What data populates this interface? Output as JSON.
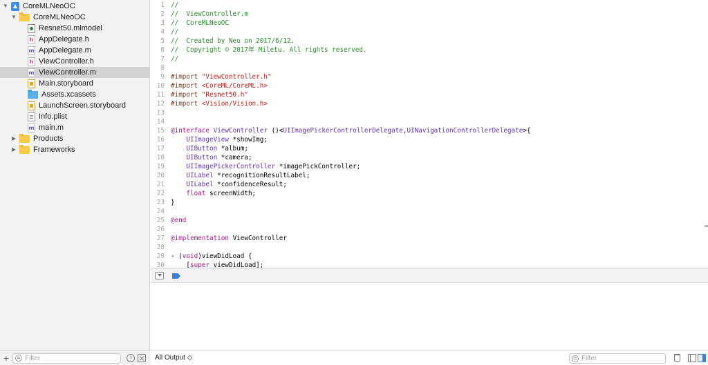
{
  "navigator": {
    "items": [
      {
        "label": "CoreMLNeoOC",
        "type": "project",
        "indent": 0,
        "expanded": true
      },
      {
        "label": "CoreMLNeoOC",
        "type": "folder",
        "indent": 1,
        "expanded": true
      },
      {
        "label": "Resnet50.mlmodel",
        "type": "model",
        "indent": 2
      },
      {
        "label": "AppDelegate.h",
        "type": "h",
        "indent": 2
      },
      {
        "label": "AppDelegate.m",
        "type": "m",
        "indent": 2
      },
      {
        "label": "ViewController.h",
        "type": "h",
        "indent": 2
      },
      {
        "label": "ViewController.m",
        "type": "m",
        "indent": 2,
        "selected": true
      },
      {
        "label": "Main.storyboard",
        "type": "storyboard",
        "indent": 2
      },
      {
        "label": "Assets.xcassets",
        "type": "assets",
        "indent": 2
      },
      {
        "label": "LaunchScreen.storyboard",
        "type": "storyboard",
        "indent": 2
      },
      {
        "label": "Info.plist",
        "type": "plist",
        "indent": 2
      },
      {
        "label": "main.m",
        "type": "m",
        "indent": 2
      },
      {
        "label": "Products",
        "type": "folder",
        "indent": 1,
        "expanded": false
      },
      {
        "label": "Frameworks",
        "type": "folder",
        "indent": 1,
        "expanded": false
      }
    ],
    "filter_placeholder": "Filter"
  },
  "editor": {
    "lines": [
      [
        [
          "t-comment",
          "//"
        ]
      ],
      [
        [
          "t-comment",
          "//  ViewController.m"
        ]
      ],
      [
        [
          "t-comment",
          "//  CoreMLNeoOC"
        ]
      ],
      [
        [
          "t-comment",
          "//"
        ]
      ],
      [
        [
          "t-comment",
          "//  Created by Neo on 2017/6/12."
        ]
      ],
      [
        [
          "t-comment",
          "//  Copyright © 2017年 Miletu. All rights reserved."
        ]
      ],
      [
        [
          "t-comment",
          "//"
        ]
      ],
      [],
      [
        [
          "t-pre",
          "#import "
        ],
        [
          "t-str",
          "\"ViewController.h\""
        ]
      ],
      [
        [
          "t-pre",
          "#import "
        ],
        [
          "t-str",
          "<CoreML/CoreML.h>"
        ]
      ],
      [
        [
          "t-pre",
          "#import "
        ],
        [
          "t-str",
          "\"Resnet50.h\""
        ]
      ],
      [
        [
          "t-pre",
          "#import "
        ],
        [
          "t-str",
          "<Vision/Vision.h>"
        ]
      ],
      [],
      [],
      [
        [
          "t-kw",
          "@interface"
        ],
        [
          "t-plain",
          " "
        ],
        [
          "t-type",
          "ViewController"
        ],
        [
          "t-plain",
          " ()<"
        ],
        [
          "t-type",
          "UIImagePickerControllerDelegate"
        ],
        [
          "t-plain",
          ","
        ],
        [
          "t-type",
          "UINavigationControllerDelegate"
        ],
        [
          "t-plain",
          ">{"
        ]
      ],
      [
        [
          "t-plain",
          "    "
        ],
        [
          "t-type",
          "UIImageView"
        ],
        [
          "t-plain",
          " *showImg;"
        ]
      ],
      [
        [
          "t-plain",
          "    "
        ],
        [
          "t-type",
          "UIButton"
        ],
        [
          "t-plain",
          " *album;"
        ]
      ],
      [
        [
          "t-plain",
          "    "
        ],
        [
          "t-type",
          "UIButton"
        ],
        [
          "t-plain",
          " *camera;"
        ]
      ],
      [
        [
          "t-plain",
          "    "
        ],
        [
          "t-type",
          "UIImagePickerController"
        ],
        [
          "t-plain",
          " *imagePickController;"
        ]
      ],
      [
        [
          "t-plain",
          "    "
        ],
        [
          "t-type",
          "UILabel"
        ],
        [
          "t-plain",
          " *recognitionResultLabel;"
        ]
      ],
      [
        [
          "t-plain",
          "    "
        ],
        [
          "t-type",
          "UILabel"
        ],
        [
          "t-plain",
          " *confidenceResult;"
        ]
      ],
      [
        [
          "t-plain",
          "    "
        ],
        [
          "t-kw",
          "float"
        ],
        [
          "t-plain",
          " screenWidth;"
        ]
      ],
      [
        [
          "t-plain",
          "}"
        ]
      ],
      [],
      [
        [
          "t-kw",
          "@end"
        ]
      ],
      [],
      [
        [
          "t-kw",
          "@implementation"
        ],
        [
          "t-plain",
          " ViewController"
        ]
      ],
      [],
      [
        [
          "t-plain",
          "- ("
        ],
        [
          "t-kw",
          "void"
        ],
        [
          "t-plain",
          ")viewDidLoad {"
        ]
      ],
      [
        [
          "t-plain",
          "    ["
        ],
        [
          "t-kw",
          "super"
        ],
        [
          "t-plain",
          " viewDidLoad];"
        ]
      ]
    ]
  },
  "console": {
    "output_selector": "All Output ◇",
    "filter_placeholder": "Filter"
  },
  "colors": {
    "comment": "#2c8a2c",
    "string": "#c41a16",
    "keyword": "#aa0d91",
    "type": "#6233a8",
    "selection": "#d3d3d3",
    "accent": "#3d7fd9"
  }
}
